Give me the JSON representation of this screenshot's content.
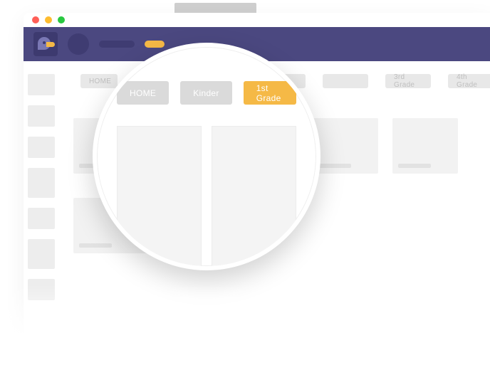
{
  "colors": {
    "brand": "#4b4880",
    "accent": "#f5b946"
  },
  "header": {
    "logo_name": "parrot-logo"
  },
  "tabs_background": [
    {
      "label": "HOME"
    },
    {
      "label": ""
    },
    {
      "label": ""
    },
    {
      "label": ""
    },
    {
      "label": ""
    },
    {
      "label": "3rd Grade"
    },
    {
      "label": "4th Grade"
    }
  ],
  "magnifier": {
    "tabs": [
      {
        "label": "HOME",
        "active": false
      },
      {
        "label": "Kinder",
        "active": false
      },
      {
        "label": "1st Grade",
        "active": true
      }
    ]
  }
}
